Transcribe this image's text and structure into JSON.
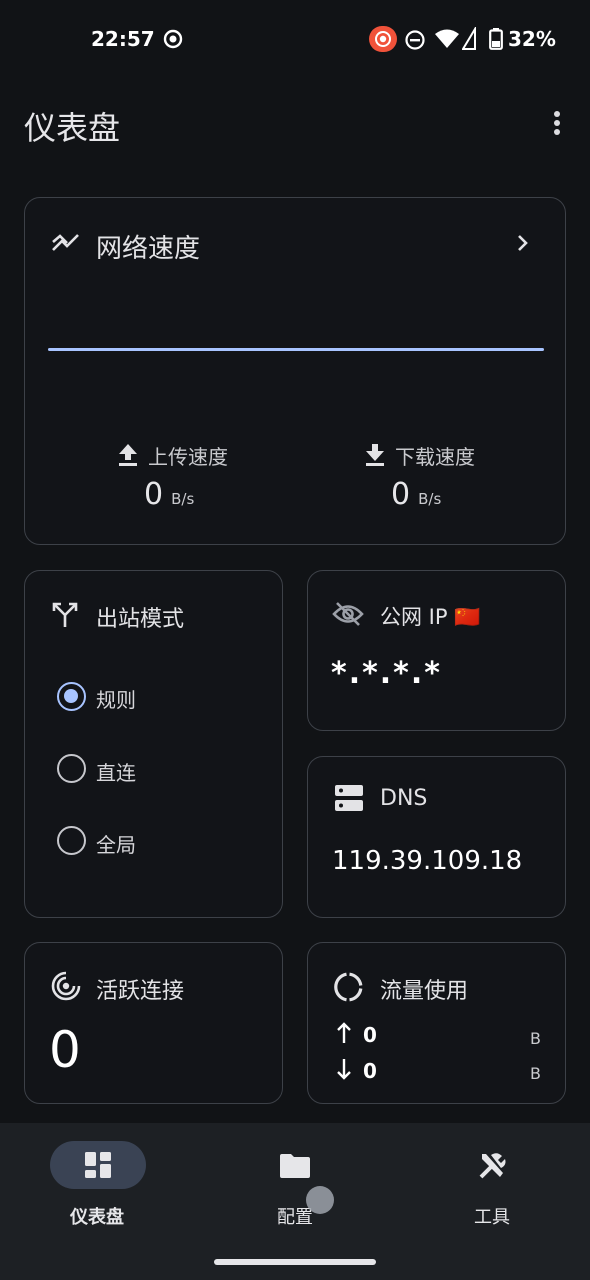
{
  "status_bar": {
    "time": "22:57",
    "battery_percent": "32%",
    "icons": [
      "notification-circle-icon",
      "record-icon",
      "dnd-icon",
      "wifi-icon",
      "battery-icon"
    ]
  },
  "header": {
    "title": "仪表盘",
    "menu_icon": "more-vert-icon"
  },
  "network_speed": {
    "title": "网络速度",
    "icon": "trending-icon",
    "chevron_icon": "chevron-right-icon",
    "upload_label": "上传速度",
    "upload_value": "0",
    "upload_unit": "B/s",
    "download_label": "下载速度",
    "download_value": "0",
    "download_unit": "B/s",
    "line_color": "#a8c4ff"
  },
  "outbound_mode": {
    "title": "出站模式",
    "icon": "fork-icon",
    "options": [
      {
        "label": "规则",
        "selected": true
      },
      {
        "label": "直连",
        "selected": false
      },
      {
        "label": "全局",
        "selected": false
      }
    ]
  },
  "public_ip": {
    "title": "公网 IP",
    "flag": "🇨🇳",
    "icon": "visibility-off-icon",
    "value": "*.*.*.*"
  },
  "dns": {
    "title": "DNS",
    "icon": "dns-server-icon",
    "value": "119.39.109.18"
  },
  "active_connections": {
    "title": "活跃连接",
    "icon": "radar-icon",
    "value": "0"
  },
  "traffic": {
    "title": "流量使用",
    "icon": "donut-icon",
    "up_value": "0",
    "up_unit": "B",
    "down_value": "0",
    "down_unit": "B"
  },
  "bottom_nav": {
    "items": [
      {
        "label": "仪表盘",
        "icon": "dashboard-icon",
        "active": true
      },
      {
        "label": "配置",
        "icon": "folder-icon",
        "active": false
      },
      {
        "label": "工具",
        "icon": "tools-icon",
        "active": false
      }
    ],
    "accent": "#3a4354"
  }
}
